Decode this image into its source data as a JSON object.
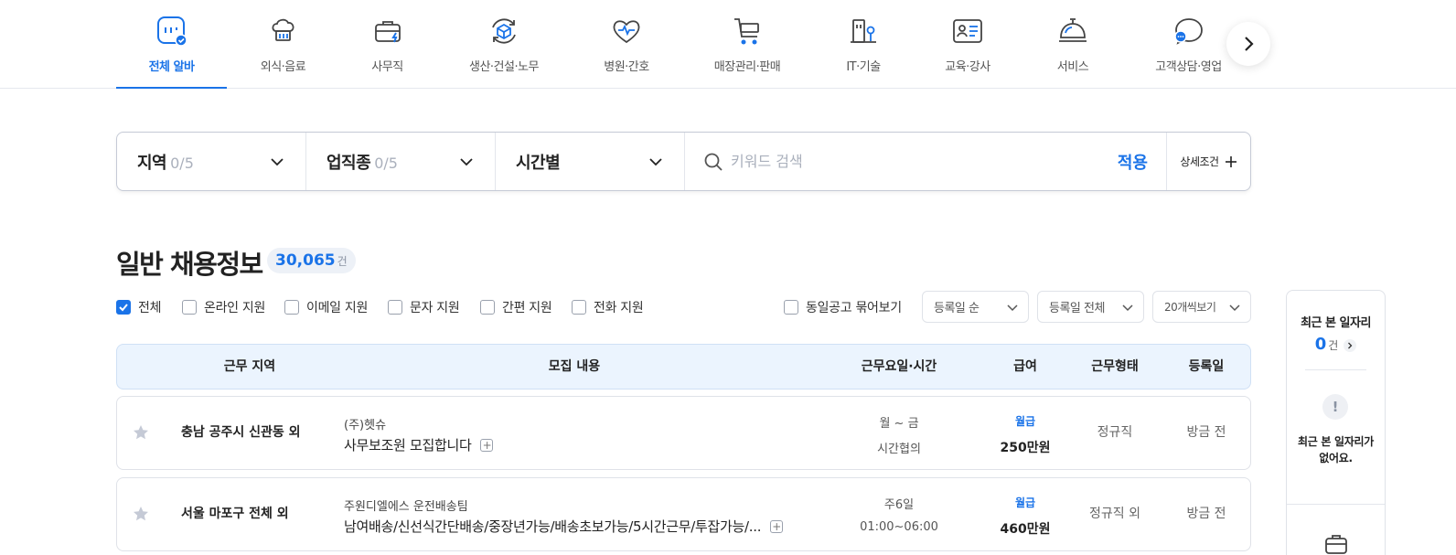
{
  "categories": [
    {
      "label": "전체 알바",
      "icon": "all-jobs-icon",
      "active": true
    },
    {
      "label": "외식·음료",
      "icon": "chef-hat-icon"
    },
    {
      "label": "사무직",
      "icon": "briefcase-icon"
    },
    {
      "label": "생산·건설·노무",
      "icon": "box-cycle-icon"
    },
    {
      "label": "병원·간호",
      "icon": "heart-pulse-icon"
    },
    {
      "label": "매장관리·판매",
      "icon": "shopping-cart-icon"
    },
    {
      "label": "IT·기술",
      "icon": "building-tech-icon"
    },
    {
      "label": "교육·강사",
      "icon": "id-card-icon"
    },
    {
      "label": "서비스",
      "icon": "service-bell-icon"
    },
    {
      "label": "고객상담·영업",
      "icon": "chat-bubble-icon"
    }
  ],
  "filter": {
    "region": {
      "label": "지역",
      "count": "0/5"
    },
    "industry": {
      "label": "업직종",
      "count": "0/5"
    },
    "time": {
      "label": "시간별"
    },
    "keyword_placeholder": "키워드 검색",
    "apply": "적용",
    "detail": "상세조건"
  },
  "list": {
    "title": "일반 채용정보",
    "count": "30,065",
    "count_unit": "건"
  },
  "options": [
    {
      "label": "전체",
      "checked": true
    },
    {
      "label": "온라인 지원",
      "checked": false
    },
    {
      "label": "이메일 지원",
      "checked": false
    },
    {
      "label": "문자 지원",
      "checked": false
    },
    {
      "label": "간편 지원",
      "checked": false
    },
    {
      "label": "전화 지원",
      "checked": false
    }
  ],
  "group_same": "동일공고 묶어보기",
  "sorts": {
    "order": "등록일 순",
    "range": "등록일 전체",
    "per_page": "20개씩보기"
  },
  "table": {
    "headers": [
      "근무 지역",
      "모집 내용",
      "근무요일·시간",
      "급여",
      "근무형태",
      "등록일"
    ],
    "rows": [
      {
        "location": "충남 공주시 신관동 외",
        "company": "(주)헷슈",
        "title": "사무보조원 모집합니다",
        "days": "월 ~ 금",
        "hours": "시간협의",
        "pay_type": "월급",
        "pay": "250만원",
        "work_type": "정규직",
        "posted": "방금 전"
      },
      {
        "location": "서울 마포구 전체 외",
        "company": "주원디엘에스 운전배송팀",
        "title": "남여배송/신선식간단배송/중장년가능/배송초보가능/5시간근무/투잡가능/...",
        "days": "주6일",
        "hours": "01:00~06:00",
        "pay_type": "월급",
        "pay": "460만원",
        "work_type": "정규직 외",
        "posted": "방금 전"
      }
    ]
  },
  "recent": {
    "title": "최근 본 일자리",
    "count": "0",
    "count_unit": "건",
    "empty_message": "최근 본 일자리가 없어요."
  },
  "colors": {
    "accent": "#1a73e8",
    "header_bg": "#ebf4fe",
    "border": "#dfe2e8"
  }
}
